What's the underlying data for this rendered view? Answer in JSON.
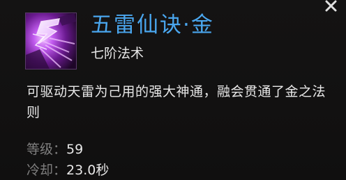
{
  "skill": {
    "icon": "purple-lightning-skill-icon",
    "title": "五雷仙诀·金",
    "rank": "七阶法术",
    "description": "可驱动天雷为己用的强大神通，融会贯通了金之法则",
    "stats": {
      "level_label": "等级：",
      "level_value": "59",
      "cooldown_label": "冷却：",
      "cooldown_value": "23.0秒"
    }
  },
  "close_icon": "close-icon",
  "colors": {
    "title": "#4aa6ee",
    "text": "#e8e8e8",
    "label": "#7f7f7f",
    "background": "#131212",
    "icon_glow": "#d58cff"
  }
}
